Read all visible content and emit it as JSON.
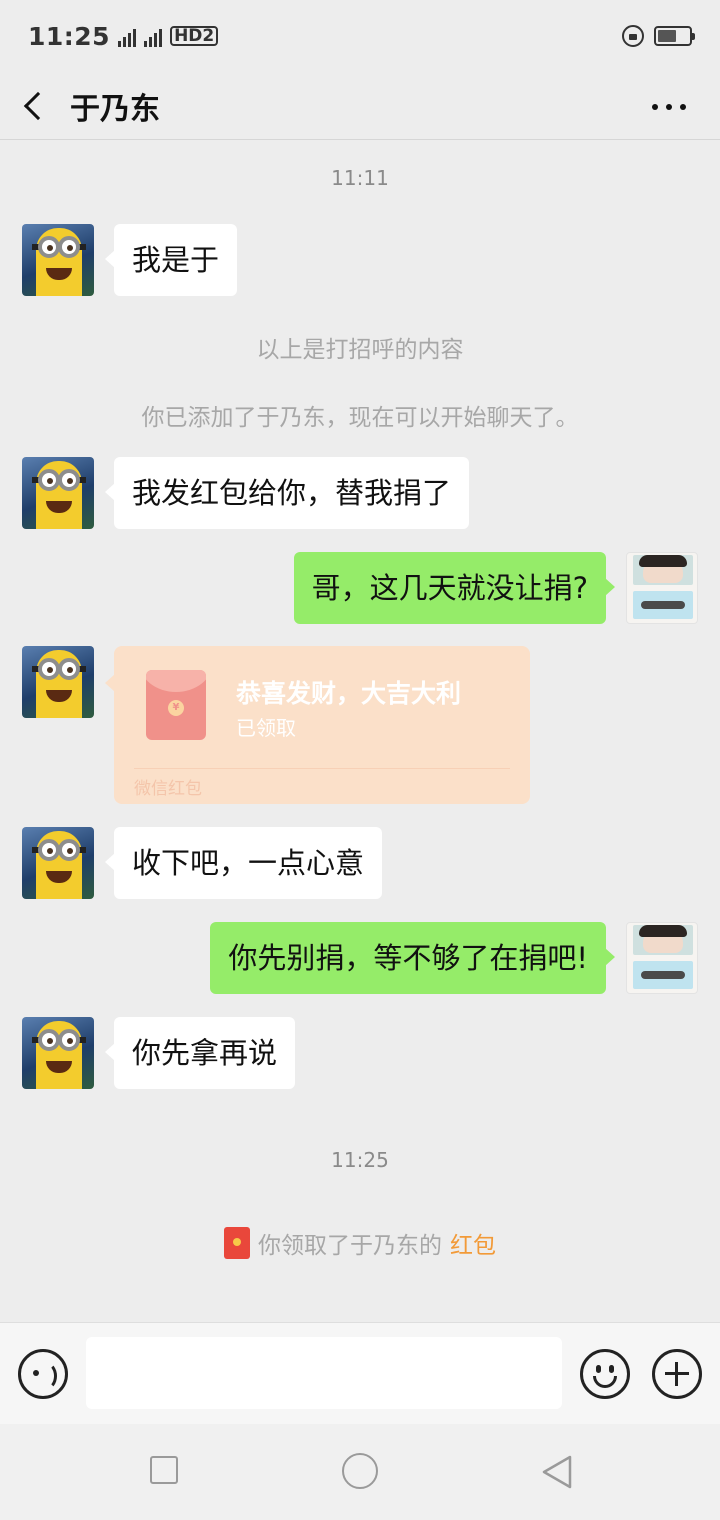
{
  "status": {
    "time": "11:25",
    "sim1": "2G",
    "sim2": "4G",
    "hd": "HD2"
  },
  "header": {
    "title": "于乃东"
  },
  "chat": {
    "time1": "11:11",
    "msg1": "我是于",
    "sys1": "以上是打招呼的内容",
    "sys2": "你已添加了于乃东，现在可以开始聊天了。",
    "msg2": "我发红包给你，替我捐了",
    "msg3": "哥，这几天就没让捐?",
    "redpacket": {
      "title": "恭喜发财，大吉大利",
      "status": "已领取",
      "footer": "微信红包",
      "coin": "¥"
    },
    "msg4": "收下吧，一点心意",
    "msg5": "你先别捐，等不够了在捐吧!",
    "msg6": "你先拿再说",
    "time2": "11:25",
    "claim": {
      "prefix": "你领取了于乃东的",
      "link": "红包"
    }
  },
  "input": {
    "value": "",
    "placeholder": ""
  },
  "colors": {
    "my_bubble": "#95ec69",
    "their_bubble": "#ffffff",
    "background": "#ededed",
    "redpacket_link": "#f29a38"
  }
}
